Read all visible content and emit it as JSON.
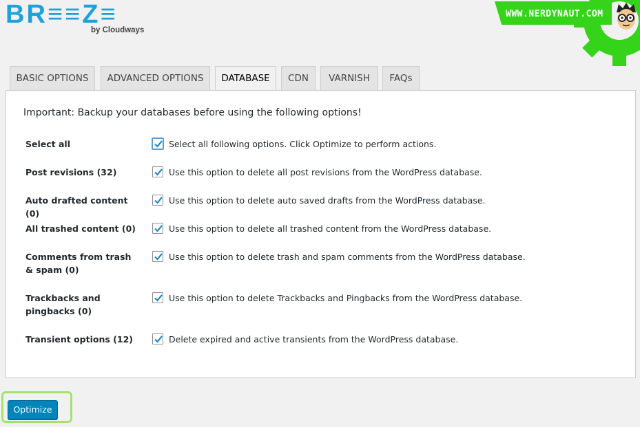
{
  "logo": {
    "text": "BR≡≡Z≡",
    "subtitle": "by Cloudways"
  },
  "watermark": {
    "text": "WWW.NERDYNAUT.COM"
  },
  "tabs": [
    {
      "label": "BASIC OPTIONS",
      "active": false
    },
    {
      "label": "ADVANCED OPTIONS",
      "active": false
    },
    {
      "label": "DATABASE",
      "active": true
    },
    {
      "label": "CDN",
      "active": false
    },
    {
      "label": "VARNISH",
      "active": false
    },
    {
      "label": "FAQs",
      "active": false
    }
  ],
  "database": {
    "notice": "Important: Backup your databases before using the following options!",
    "options": [
      {
        "label": "Select all",
        "description": "Select all following options. Click Optimize to perform actions.",
        "checked": true
      },
      {
        "label": "Post revisions (32)",
        "description": "Use this option to delete all post revisions from the WordPress database.",
        "checked": true
      },
      {
        "label": "Auto drafted content (0)",
        "description": "Use this option to delete auto saved drafts from the WordPress database.",
        "checked": true
      },
      {
        "label": "All trashed content (0)",
        "description": "Use this option to delete all trashed content from the WordPress database.",
        "checked": true
      },
      {
        "label": "Comments from trash & spam (0)",
        "description": "Use this option to delete trash and spam comments from the WordPress database.",
        "checked": true
      },
      {
        "label": "Trackbacks and pingbacks (0)",
        "description": "Use this option to delete Trackbacks and Pingbacks from the WordPress database.",
        "checked": true
      },
      {
        "label": "Transient options (12)",
        "description": "Delete expired and active transients from the WordPress database.",
        "checked": true
      }
    ]
  },
  "actions": {
    "optimize_label": "Optimize"
  },
  "colors": {
    "brand": "#1fa2dc",
    "button": "#0085ba",
    "check": "#1e8cbe",
    "highlight": "#a4e36a",
    "watermark": "#35d41b"
  }
}
